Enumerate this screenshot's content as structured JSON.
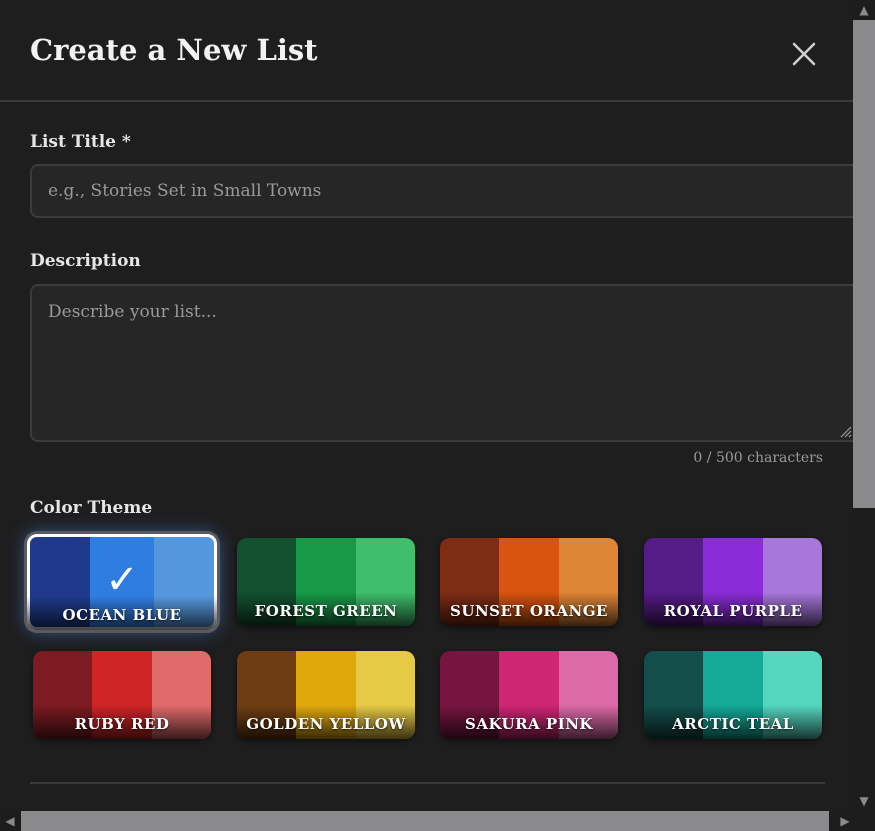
{
  "modal": {
    "title": "Create a New List",
    "close_icon": "close-icon"
  },
  "form": {
    "title_label": "List Title *",
    "title_placeholder": "e.g., Stories Set in Small Towns",
    "title_value": "",
    "description_label": "Description",
    "description_placeholder": "Describe your list...",
    "description_value": "",
    "char_counter": "0 / 500 characters",
    "theme_label": "Color Theme"
  },
  "themes": [
    {
      "name": "OCEAN BLUE",
      "colors": [
        "#1f3a8a",
        "#2f7de0",
        "#5497dc"
      ],
      "selected": true
    },
    {
      "name": "FOREST GREEN",
      "colors": [
        "#135130",
        "#179a48",
        "#3fbf6c"
      ],
      "selected": false
    },
    {
      "name": "SUNSET ORANGE",
      "colors": [
        "#7e2c14",
        "#d9540e",
        "#df8536"
      ],
      "selected": false
    },
    {
      "name": "ROYAL PURPLE",
      "colors": [
        "#551b86",
        "#8a2cd8",
        "#a877dc"
      ],
      "selected": false
    },
    {
      "name": "RUBY RED",
      "colors": [
        "#7c1b21",
        "#cf2527",
        "#e16a6b"
      ],
      "selected": false
    },
    {
      "name": "GOLDEN YELLOW",
      "colors": [
        "#6f3d12",
        "#dfa80c",
        "#e6c945"
      ],
      "selected": false
    },
    {
      "name": "SAKURA PINK",
      "colors": [
        "#76153f",
        "#cf2674",
        "#dd6aa8"
      ],
      "selected": false
    },
    {
      "name": "ARCTIC TEAL",
      "colors": [
        "#134e4a",
        "#14a998",
        "#55d6bf"
      ],
      "selected": false
    }
  ],
  "check_glyph": "✓",
  "scrollbar_arrows": {
    "up": "▲",
    "down": "▼",
    "left": "◀",
    "right": "▶"
  }
}
